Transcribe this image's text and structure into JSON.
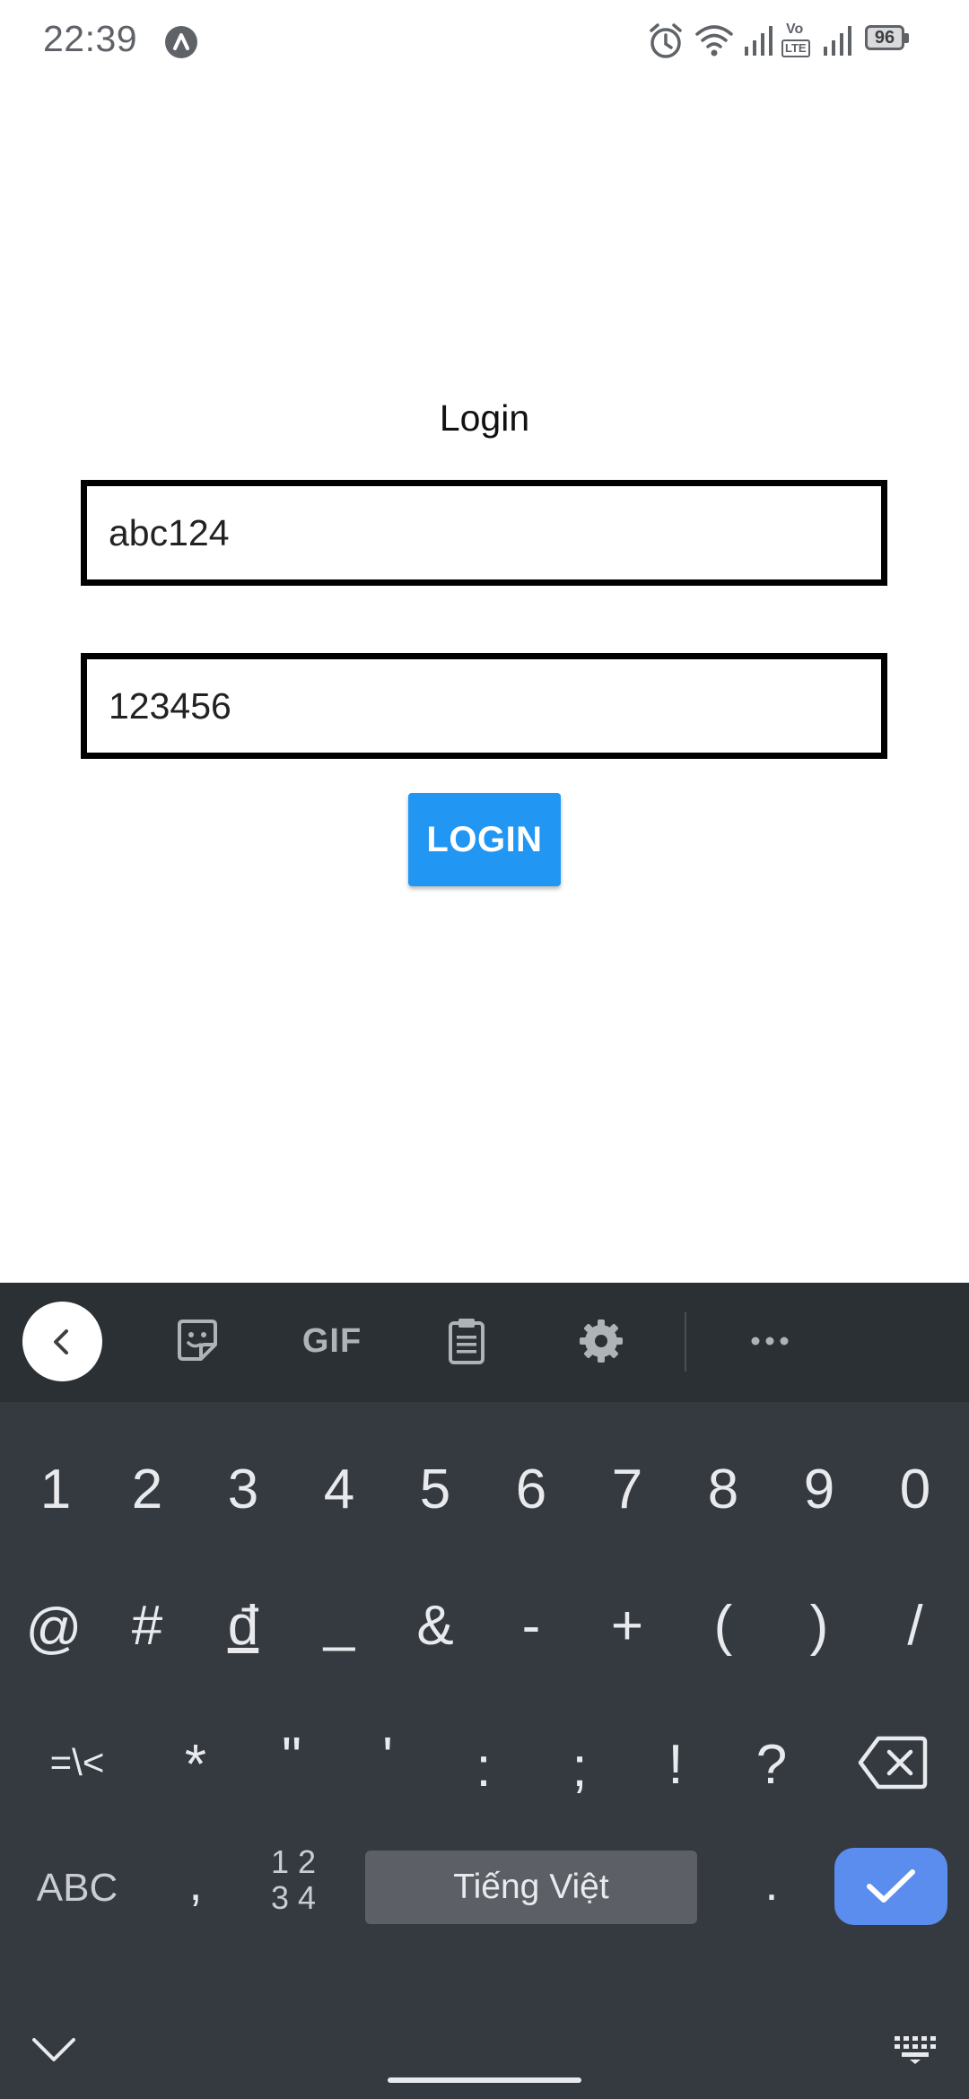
{
  "status_bar": {
    "time": "22:39",
    "battery": "96",
    "volte": "Vo",
    "lte": "LTE",
    "icons": [
      "app-notification-icon",
      "alarm-icon",
      "wifi-icon",
      "signal-icon",
      "volte-icon",
      "signal-icon",
      "battery-icon"
    ]
  },
  "login": {
    "title": "Login",
    "username_value": "abc124",
    "password_value": "123456",
    "button_label": "LOGIN",
    "button_color": "#2196f3"
  },
  "keyboard": {
    "toolbar": {
      "gif_label": "GIF",
      "icons": [
        "back-icon",
        "sticker-icon",
        "gif-icon",
        "clipboard-icon",
        "settings-icon",
        "more-icon"
      ]
    },
    "row1": [
      "1",
      "2",
      "3",
      "4",
      "5",
      "6",
      "7",
      "8",
      "9",
      "0"
    ],
    "row2": [
      "@",
      "#",
      "đ",
      "_",
      "&",
      "-",
      "+",
      "(",
      ")",
      "/"
    ],
    "row3": [
      "=\\<",
      "*",
      "\"",
      "'",
      ":",
      ";",
      "!",
      "?"
    ],
    "row4": {
      "abc": "ABC",
      "comma": ",",
      "numpad_top": "1 2",
      "numpad_bottom": "3 4",
      "space": "Tiếng Việt",
      "period": "."
    },
    "background": "#353a40",
    "enter_color": "#5a8dee"
  }
}
